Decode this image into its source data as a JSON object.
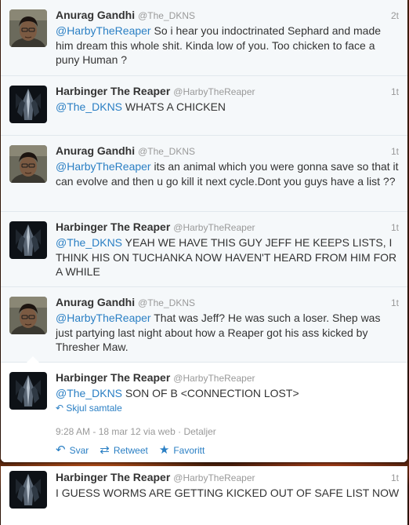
{
  "tweets": [
    {
      "name": "Anurag Gandhi",
      "handle": "@The_DKNS",
      "time": "2t",
      "mention": "@HarbyTheReaper",
      "text": " So i hear you indoctrinated Sephard and made him dream this whole shit. Kinda low of you. Too chicken to face a puny Human ?",
      "avatar": "face-avatar"
    },
    {
      "name": "Harbinger The Reaper",
      "handle": "@HarbyTheReaper",
      "time": "1t",
      "mention": "@The_DKNS",
      "text": " WHATS A CHICKEN",
      "avatar": "reaper-avatar"
    },
    {
      "name": "Anurag Gandhi",
      "handle": "@The_DKNS",
      "time": "1t",
      "mention": "@HarbyTheReaper",
      "text": " its an animal which you were gonna save so that it can evolve and then u go kill it next cycle.Dont you guys have a list ??",
      "avatar": "face-avatar"
    },
    {
      "name": "Harbinger The Reaper",
      "handle": "@HarbyTheReaper",
      "time": "1t",
      "mention": "@The_DKNS",
      "text": " YEAH WE HAVE THIS GUY JEFF HE KEEPS LISTS, I THINK HIS ON TUCHANKA NOW HAVEN'T HEARD FROM HIM FOR A WHILE",
      "avatar": "reaper-avatar"
    },
    {
      "name": "Anurag Gandhi",
      "handle": "@The_DKNS",
      "time": "1t",
      "mention": "@HarbyTheReaper",
      "text": " That was Jeff? He was such a loser. Shep was just partying last night about how a Reaper got his ass kicked by Thresher Maw.",
      "avatar": "face-avatar"
    },
    {
      "name": "Harbinger The Reaper",
      "handle": "@HarbyTheReaper",
      "mention": "@The_DKNS",
      "text": " SON OF B <CONNECTION LOST>",
      "avatar": "reaper-avatar"
    }
  ],
  "open_tweet": {
    "hide_conversation": "Skjul samtale",
    "meta_time": "9:28 AM - 18 mar 12 via web",
    "meta_sep": "·",
    "meta_details": "Detaljer",
    "reply_label": "Svar",
    "retweet_label": "Retweet",
    "favorite_label": "Favoritt"
  },
  "bottom_tweet": {
    "name": "Harbinger The Reaper",
    "handle": "@HarbyTheReaper",
    "time": "1t",
    "text": "I GUESS WORMS ARE GETTING KICKED OUT OF SAFE LIST NOW",
    "avatar": "reaper-avatar"
  },
  "colors": {
    "link": "#2a7fc4",
    "muted": "#999999",
    "text": "#333333"
  }
}
